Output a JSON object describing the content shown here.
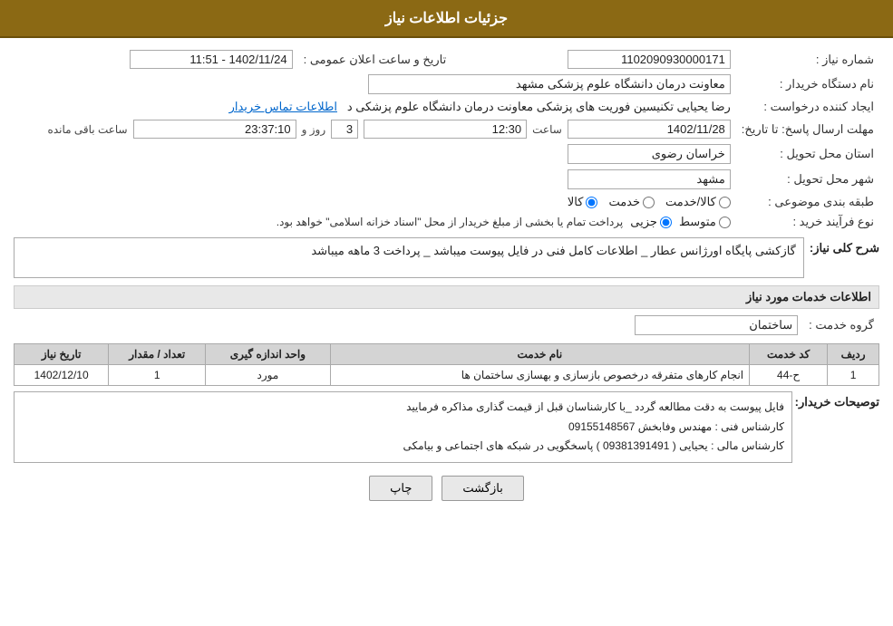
{
  "header": {
    "title": "جزئیات اطلاعات نیاز"
  },
  "fields": {
    "need_number_label": "شماره نیاز :",
    "need_number_value": "1102090930000171",
    "buyer_org_label": "نام دستگاه خریدار :",
    "buyer_org_value": "معاونت درمان دانشگاه علوم پزشکی مشهد",
    "creator_label": "ایجاد کننده درخواست :",
    "creator_value": "رضا یحیایی تکنیسین فوریت های پزشکی معاونت درمان دانشگاه علوم پزشکی د",
    "creator_link": "اطلاعات تماس خریدار",
    "announce_datetime_label": "تاریخ و ساعت اعلان عمومی :",
    "announce_datetime_value": "1402/11/24 - 11:51",
    "response_deadline_label": "مهلت ارسال پاسخ: تا تاریخ:",
    "response_date_value": "1402/11/28",
    "response_time_value": "12:30",
    "response_days_value": "3",
    "response_time_remaining": "23:37:10",
    "response_time_unit": "ساعت باقی مانده",
    "response_days_label": "روز و",
    "province_label": "استان محل تحویل :",
    "province_value": "خراسان رضوی",
    "city_label": "شهر محل تحویل :",
    "city_value": "مشهد",
    "category_label": "طبقه بندی موضوعی :",
    "category_options": [
      "کالا",
      "خدمت",
      "کالا/خدمت"
    ],
    "category_selected": "کالا",
    "process_label": "نوع فرآیند خرید :",
    "process_options": [
      "جزیی",
      "متوسط"
    ],
    "process_note": "پرداخت تمام یا بخشی از مبلغ خریدار از محل \"اسناد خزانه اسلامی\" خواهد بود.",
    "need_desc_label": "شرح کلی نیاز:",
    "need_desc_value": "گازکشی پایگاه اورژانس عطار _ اطلاعات کامل فنی در فایل پیوست میباشد _ پرداخت 3 ماهه میباشد",
    "services_section_label": "اطلاعات خدمات مورد نیاز",
    "service_group_label": "گروه خدمت :",
    "service_group_value": "ساختمان",
    "table_headers": {
      "row_num": "ردیف",
      "service_code": "کد خدمت",
      "service_name": "نام خدمت",
      "unit": "واحد اندازه گیری",
      "quantity": "تعداد / مقدار",
      "need_date": "تاریخ نیاز"
    },
    "table_rows": [
      {
        "row_num": "1",
        "service_code": "ح-44",
        "service_name": "انجام کارهای متفرقه درخصوص بازسازی و بهسازی ساختمان ها",
        "unit": "مورد",
        "quantity": "1",
        "need_date": "1402/12/10"
      }
    ],
    "buyer_desc_label": "توصیحات خریدار:",
    "buyer_desc_lines": [
      "فایل پیوست به دقت مطالعه گردد _با کارشناسان قبل از قیمت گذاری مذاکره فرمایید",
      "کارشناس فنی : مهندس وفابخش 09155148567",
      "کارشناس مالی : یحیایی ( 09381391491 ) پاسخگویی در شبکه های اجتماعی و بیامکی"
    ]
  },
  "buttons": {
    "back_label": "بازگشت",
    "print_label": "چاپ"
  }
}
